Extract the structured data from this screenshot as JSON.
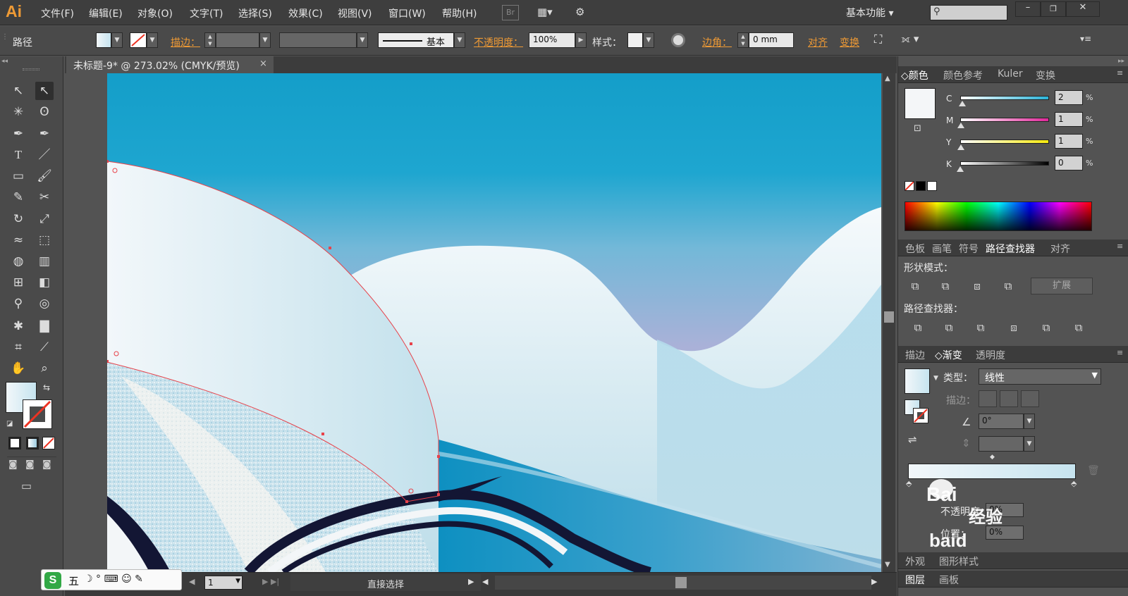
{
  "app": {
    "logo": "Ai",
    "workspace": "基本功能"
  },
  "menu": [
    "文件(F)",
    "编辑(E)",
    "对象(O)",
    "文字(T)",
    "选择(S)",
    "效果(C)",
    "视图(V)",
    "窗口(W)",
    "帮助(H)"
  ],
  "bridge_label": "Br",
  "options": {
    "selection_type": "路径",
    "stroke_label": "描边：",
    "stroke_profile": "基本",
    "opacity_label": "不透明度：",
    "opacity_value": "100%",
    "style_label": "样式：",
    "corner_label": "边角：",
    "corner_value": "0 mm",
    "align_label": "对齐",
    "transform_label": "变换"
  },
  "document": {
    "tab_title": "未标题-9* @ 273.02% (CMYK/预览)",
    "close": "×"
  },
  "status": {
    "page": "1",
    "tool": "直接选择"
  },
  "colors": {
    "accent": "#ee9a35",
    "sky_top": "#139ec9",
    "cyan": "#2ab3d8",
    "magenta": "#e0289a",
    "yellow": "#f5e90e",
    "dark_blue": "#131634"
  },
  "color_panel": {
    "tabs": [
      "颜色",
      "颜色参考",
      "Kuler",
      "变换"
    ],
    "channels": [
      {
        "label": "C",
        "value": "2",
        "unit": "%",
        "fraction": 0.02
      },
      {
        "label": "M",
        "value": "1",
        "unit": "%",
        "fraction": 0.01
      },
      {
        "label": "Y",
        "value": "1",
        "unit": "%",
        "fraction": 0.01
      },
      {
        "label": "K",
        "value": "0",
        "unit": "%",
        "fraction": 0.0
      }
    ]
  },
  "pathfinder_panel": {
    "tabs": [
      "色板",
      "画笔",
      "符号",
      "路径查找器",
      "对齐"
    ],
    "shape_modes_label": "形状模式：",
    "expand_label": "扩展",
    "pathfinders_label": "路径查找器："
  },
  "gradient_panel": {
    "tabs": [
      "描边",
      "渐变",
      "透明度"
    ],
    "type_label": "类型：",
    "type_value": "线性",
    "stroke_label": "描边：",
    "angle_value": "0°",
    "opacity_label": "不透明度：",
    "opacity_value": "0%",
    "location_label": "位置：",
    "location_value": "0%"
  },
  "bottom_panels": {
    "tabs1": [
      "外观",
      "图形样式"
    ],
    "tabs2": [
      "图层",
      "画板"
    ]
  },
  "watermark": {
    "top": "Bai",
    "mid": "经验",
    "bottom": "baid"
  },
  "ime": {
    "logo": "S",
    "mode": "五"
  }
}
